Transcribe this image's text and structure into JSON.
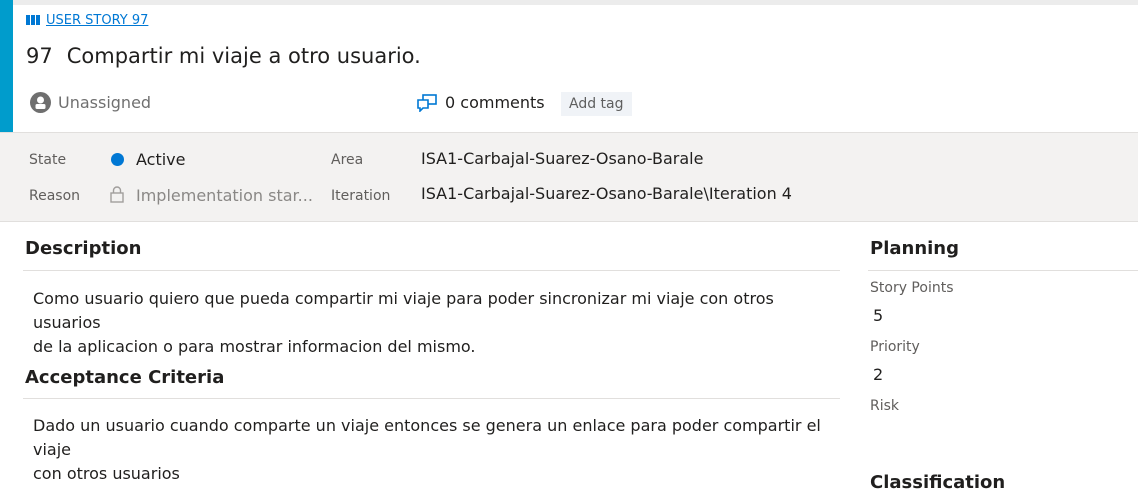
{
  "header": {
    "work_item_type": "USER STORY 97",
    "id": "97",
    "title": "Compartir mi viaje a otro usuario.",
    "assigned_to": "Unassigned",
    "comments": "0 comments",
    "add_tag": "Add tag",
    "accent_color": "#009ccc"
  },
  "fields": {
    "state_label": "State",
    "state_value": "Active",
    "state_color": "#0078d4",
    "reason_label": "Reason",
    "reason_value": "Implementation star...",
    "area_label": "Area",
    "area_value": "ISA1-Carbajal-Suarez-Osano-Barale",
    "iteration_label": "Iteration",
    "iteration_value": "ISA1-Carbajal-Suarez-Osano-Barale\\Iteration 4"
  },
  "description": {
    "heading": "Description",
    "line1": "Como usuario quiero que pueda compartir mi viaje para poder sincronizar mi viaje con otros usuarios",
    "line2": "de la aplicacion o para mostrar informacion del mismo."
  },
  "acceptance": {
    "heading": "Acceptance Criteria",
    "line1": "Dado un usuario cuando comparte un viaje entonces se genera un enlace para poder compartir el viaje",
    "line2": "con otros usuarios"
  },
  "planning": {
    "heading": "Planning",
    "story_points_label": "Story Points",
    "story_points_value": "5",
    "priority_label": "Priority",
    "priority_value": "2",
    "risk_label": "Risk",
    "classification_heading": "Classification"
  }
}
